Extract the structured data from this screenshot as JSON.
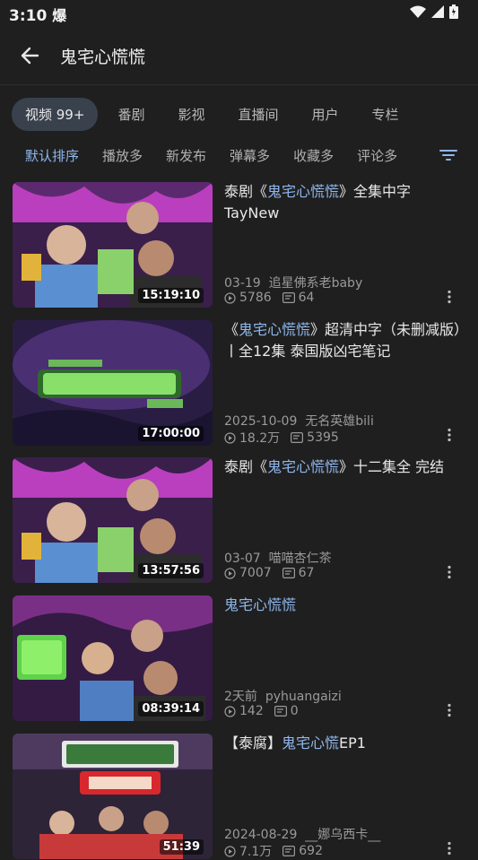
{
  "status": {
    "time": "3:10",
    "extra_glyph": "爆"
  },
  "header": {
    "title": "鬼宅心慌慌"
  },
  "tabs": [
    "视频 99+",
    "番剧",
    "影视",
    "直播间",
    "用户",
    "专栏"
  ],
  "sorts": [
    "默认排序",
    "播放多",
    "新发布",
    "弹幕多",
    "收藏多",
    "评论多"
  ],
  "colors": {
    "accent": "#8fb8ee",
    "background": "#1f1f1f",
    "active_tab_bg": "#39414d"
  },
  "videos": [
    {
      "title": [
        {
          "t": "泰剧《"
        },
        {
          "t": "鬼宅心慌慌",
          "h": true
        },
        {
          "t": "》全集中字 TayNew"
        }
      ],
      "duration": "15:19:10",
      "date": "03-19",
      "uploader": "追星佛系老baby",
      "views": "5786",
      "danmaku": "64"
    },
    {
      "title": [
        {
          "t": "《"
        },
        {
          "t": "鬼宅心慌慌",
          "h": true
        },
        {
          "t": "》超清中字（未删减版）丨全12集 泰国版凶宅笔记"
        }
      ],
      "duration": "17:00:00",
      "date": "2025-10-09",
      "uploader": "无名英雄bili",
      "views": "18.2万",
      "danmaku": "5395"
    },
    {
      "title": [
        {
          "t": "泰剧《"
        },
        {
          "t": "鬼宅心慌慌",
          "h": true
        },
        {
          "t": "》十二集全 完结"
        }
      ],
      "duration": "13:57:56",
      "date": "03-07",
      "uploader": "喵喵杏仁茶",
      "views": "7007",
      "danmaku": "67"
    },
    {
      "title": [
        {
          "t": "鬼宅心慌慌",
          "h": true
        }
      ],
      "duration": "08:39:14",
      "date": "2天前",
      "uploader": "pyhuangaizi",
      "views": "142",
      "danmaku": "0"
    },
    {
      "title": [
        {
          "t": "【泰腐】"
        },
        {
          "t": "鬼宅心慌",
          "h": true
        },
        {
          "t": "EP1"
        }
      ],
      "duration": "51:39",
      "date": "2024-08-29",
      "uploader": "__娜乌西卡__",
      "views": "7.1万",
      "danmaku": "692"
    }
  ]
}
